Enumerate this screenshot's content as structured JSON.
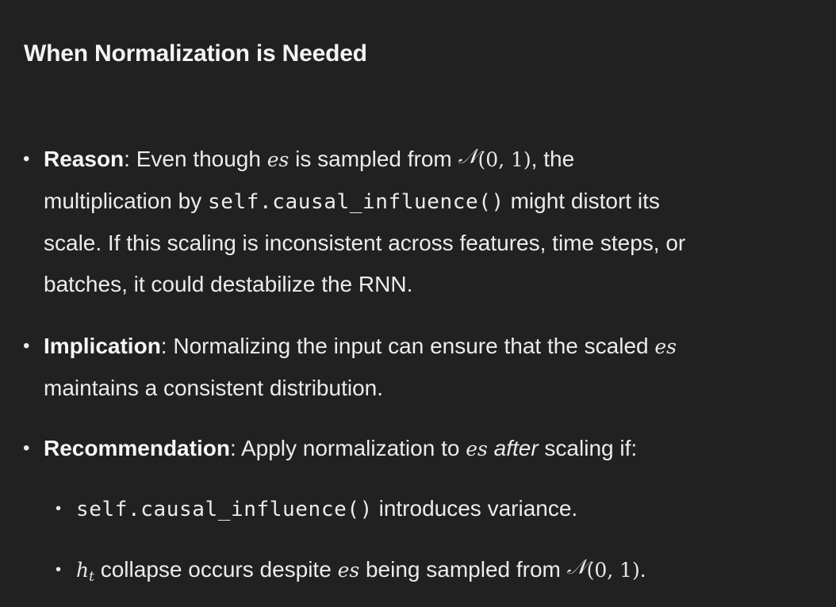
{
  "heading": "When Normalization is Needed",
  "items": [
    {
      "label": "Reason",
      "text_1": ": Even though ",
      "math_1": "es",
      "text_2": " is sampled from ",
      "math_dist": "𝒩",
      "math_dist_args": "(0, 1)",
      "text_3": ", the",
      "text_4": "multiplication by ",
      "code_1": "self.causal_influence()",
      "text_5": " might distort its",
      "text_6": "scale. If this scaling is inconsistent across features, time steps, or",
      "text_7": "batches, it could destabilize the RNN."
    },
    {
      "label": "Implication",
      "text_1": ": Normalizing the input can ensure that the scaled ",
      "math_1": "es",
      "text_2": "maintains a consistent distribution."
    },
    {
      "label": "Recommendation",
      "text_1": ": Apply normalization to ",
      "math_1": "es",
      "emph": "after",
      "text_2": " scaling if:"
    }
  ],
  "subitems": [
    {
      "code_1": "self.causal_influence()",
      "text_1": " introduces variance."
    },
    {
      "math_h": "h",
      "math_t": "t",
      "text_1": " collapse occurs despite ",
      "math_1": "es",
      "text_2": " being sampled from ",
      "math_dist": "𝒩",
      "math_dist_args": "(0, 1)",
      "text_3": "."
    }
  ],
  "bullet_glyph": "•"
}
